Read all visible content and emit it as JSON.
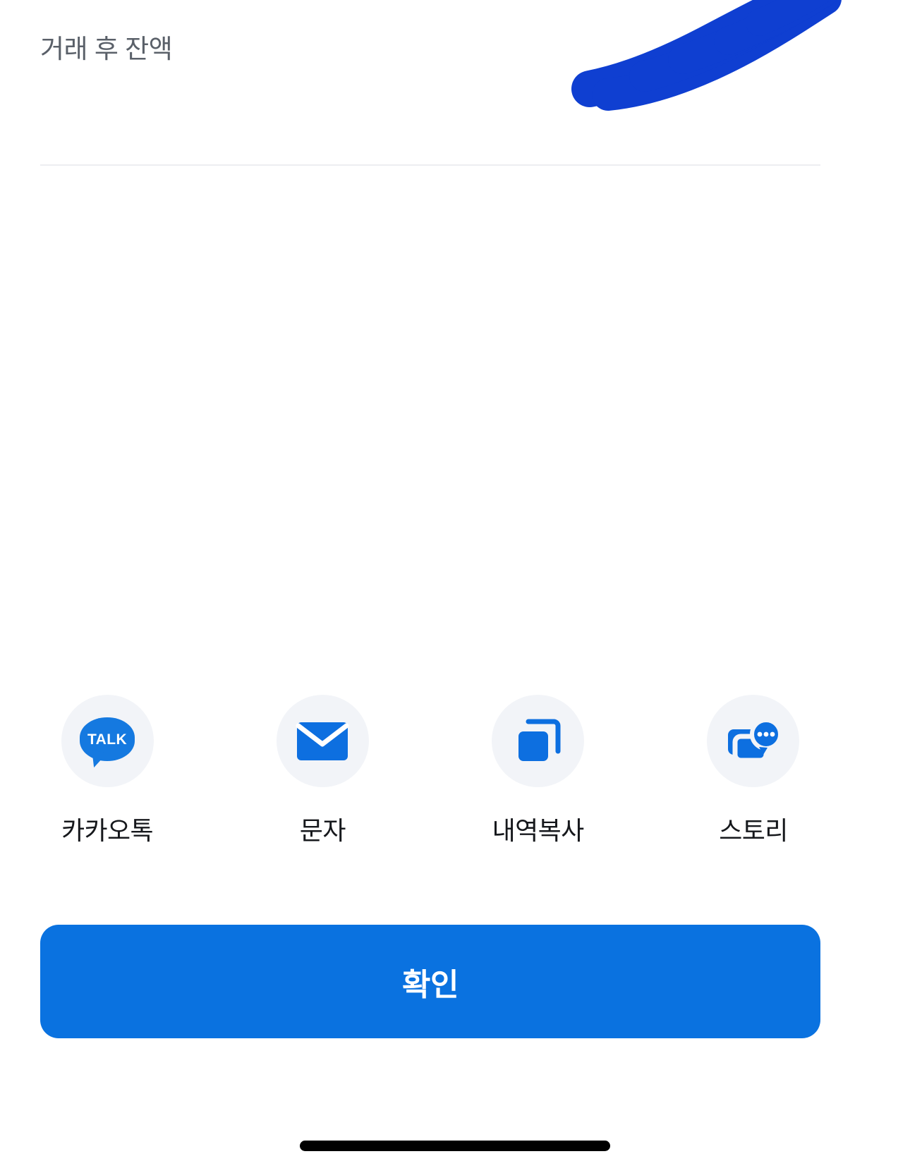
{
  "screen": {
    "title": "거래 후 잔액 결과 화면",
    "background_color": "#ffffff"
  },
  "summary": {
    "label": "거래 후 잔액",
    "label_color": "#5a6069",
    "value_redacted": true,
    "redaction_color": "#0f3fd1"
  },
  "divider": {
    "color": "#edeef1"
  },
  "share": {
    "items": [
      {
        "id": "kakaotalk",
        "label": "카카오톡",
        "icon": "kakaotalk-bubble-icon",
        "icon_text": "TALK",
        "icon_color": "#1579e0",
        "circle_color": "#f2f4f8"
      },
      {
        "id": "sms",
        "label": "문자",
        "icon": "envelope-icon",
        "icon_color": "#0d6fe0",
        "circle_color": "#f2f4f8"
      },
      {
        "id": "copy",
        "label": "내역복사",
        "icon": "copy-icon",
        "icon_color": "#0d6fe0",
        "circle_color": "#f2f4f8"
      },
      {
        "id": "story",
        "label": "스토리",
        "icon": "story-chat-icon",
        "icon_color": "#0d6fe0",
        "circle_color": "#f2f4f8"
      }
    ]
  },
  "confirm": {
    "label": "확인",
    "background_color": "#0a72e0",
    "text_color": "#ffffff"
  },
  "home_indicator": {
    "color": "#000000"
  }
}
